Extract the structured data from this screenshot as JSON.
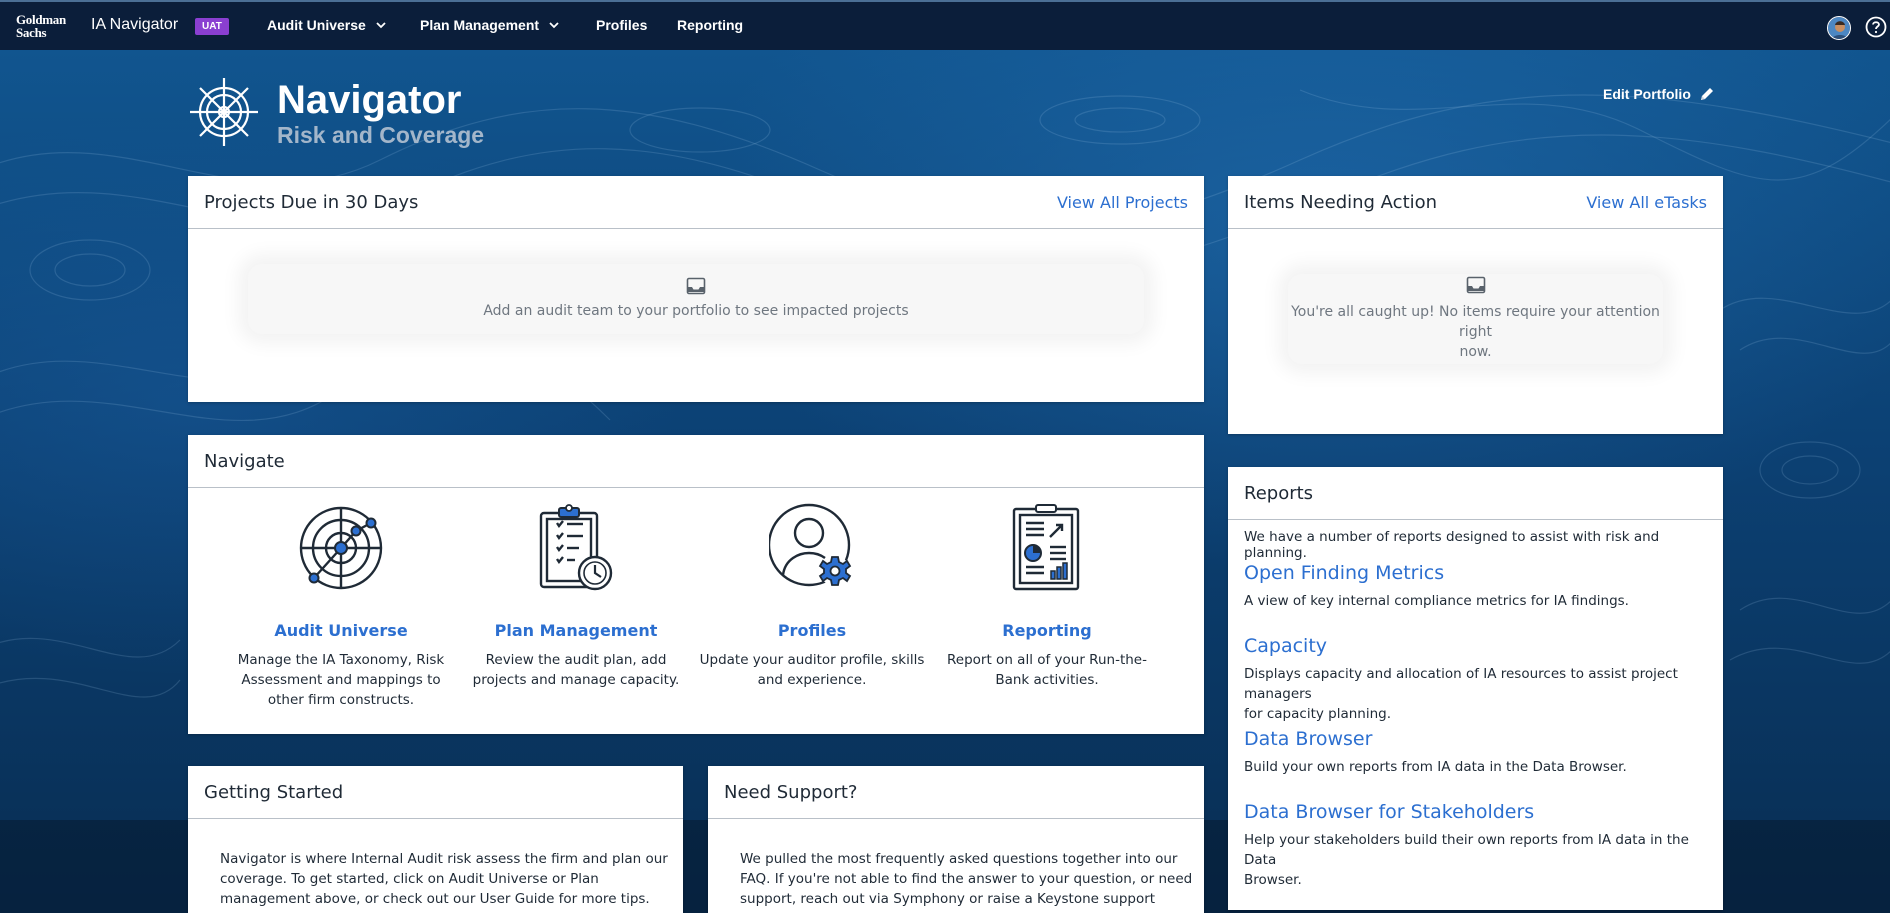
{
  "nav": {
    "logo_line1": "Goldman",
    "logo_line2": "Sachs",
    "app_title": "IA Navigator",
    "env_badge": "UAT",
    "items": [
      {
        "label": "Audit Universe"
      },
      {
        "label": "Plan Management"
      },
      {
        "label": "Profiles"
      },
      {
        "label": "Reporting"
      }
    ]
  },
  "hero": {
    "title": "Navigator",
    "subtitle": "Risk and Coverage",
    "edit_label": "Edit Portfolio"
  },
  "projects_card": {
    "title": "Projects Due in 30 Days",
    "link": "View All Projects",
    "empty_text": "Add an audit team to your portfolio to see impacted projects"
  },
  "items_card": {
    "title": "Items Needing Action",
    "link": "View All eTasks",
    "empty_line1": "You're all caught up! No items require your attention right",
    "empty_line2": "now."
  },
  "navigate_card": {
    "title": "Navigate",
    "tiles": [
      {
        "label": "Audit Universe",
        "desc1": "Manage the IA Taxonomy, Risk",
        "desc2": "Assessment and mappings to",
        "desc3": "other firm constructs."
      },
      {
        "label": "Plan Management",
        "desc1": "Review the audit plan, add",
        "desc2": "projects and manage capacity.",
        "desc3": ""
      },
      {
        "label": "Profiles",
        "desc1": "Update your auditor profile, skills",
        "desc2": "and experience.",
        "desc3": ""
      },
      {
        "label": "Reporting",
        "desc1": "Report on all of your Run-the-",
        "desc2": "Bank activities.",
        "desc3": ""
      }
    ]
  },
  "reports_card": {
    "title": "Reports",
    "intro": "We have a number of reports designed to assist with risk and planning.",
    "reports": [
      {
        "name": "Open Finding Metrics",
        "desc1": "A view of key internal compliance metrics for IA findings.",
        "desc2": ""
      },
      {
        "name": "Capacity",
        "desc1": "Displays capacity and allocation of IA resources to assist project managers",
        "desc2": "for capacity planning."
      },
      {
        "name": "Data Browser",
        "desc1": "Build your own reports from IA data in the Data Browser.",
        "desc2": ""
      },
      {
        "name": "Data Browser for Stakeholders",
        "desc1": "Help your stakeholders build their own reports from IA data in the Data",
        "desc2": "Browser."
      }
    ]
  },
  "getting_started": {
    "title": "Getting Started",
    "line1": "Navigator is where Internal Audit risk assess the firm and plan our",
    "line2": "coverage. To get started, click on Audit Universe or Plan",
    "line3": "management above, or check out our User Guide for more tips."
  },
  "need_support": {
    "title": "Need Support?",
    "line1": "We pulled the most frequently asked questions together into our",
    "line2": "FAQ. If you're not able to find the answer to your question, or need",
    "line3": "support, reach out via Symphony or raise a Keystone support request."
  },
  "colors": {
    "nav_bg": "#0b1e3a",
    "link": "#2c6fd0",
    "badge": "#8a3fd1"
  },
  "icons": [
    "chevron-down-icon",
    "avatar",
    "help-icon",
    "ship-wheel-icon",
    "pencil-icon",
    "inbox-icon",
    "radar-icon",
    "clipboard-clock-icon",
    "user-gear-icon",
    "report-document-icon"
  ]
}
